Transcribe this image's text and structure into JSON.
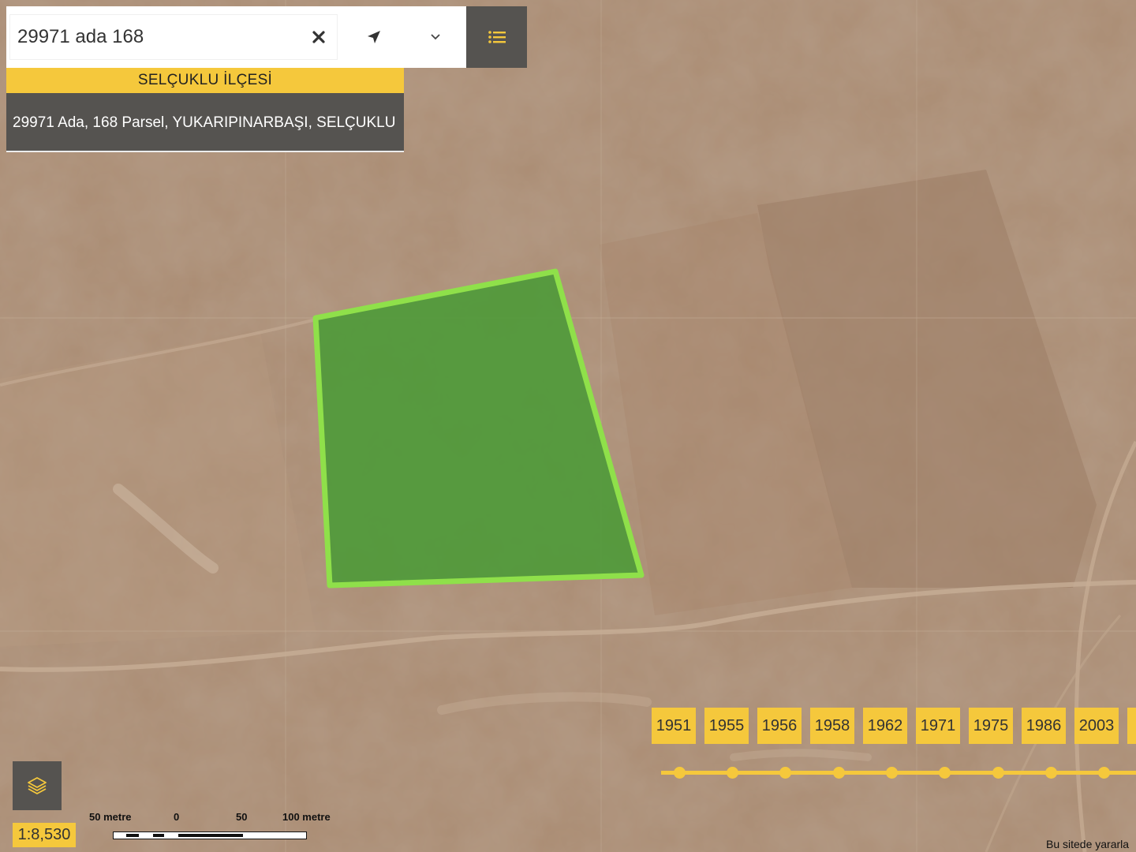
{
  "search": {
    "value": "29971 ada 168",
    "clear_icon": "close-icon",
    "locate_icon": "location-arrow-icon",
    "dropdown_icon": "chevron-down-icon",
    "menu_icon": "list-icon"
  },
  "results": {
    "district": "SELÇUKLU İLÇESİ",
    "item": "29971 Ada, 168 Parsel, YUKARIPINARBAŞI, SELÇUKLU"
  },
  "timeline": {
    "years": [
      "1951",
      "1955",
      "1956",
      "1958",
      "1962",
      "1971",
      "1975",
      "1986",
      "2003"
    ]
  },
  "map": {
    "parcel_fill": "#4f9a3a",
    "parcel_stroke": "#8fe04a",
    "accent": "#f5c83c",
    "panel_dark": "#555350"
  },
  "layers": {
    "icon": "layers-icon"
  },
  "scale": {
    "ratio": "1:8,530",
    "labels": [
      "50 metre",
      "0",
      "50",
      "100 metre"
    ]
  },
  "footer": {
    "note": "Bu sitede yararla"
  }
}
